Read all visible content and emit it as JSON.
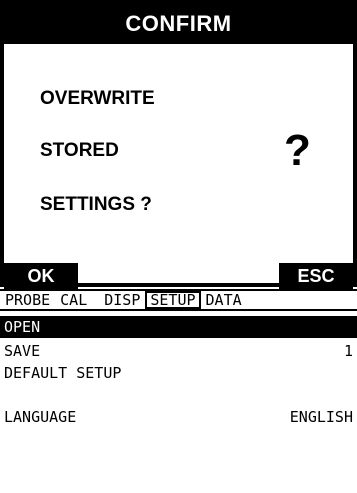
{
  "dialog": {
    "title": "CONFIRM",
    "lines": [
      "OVERWRITE",
      "STORED",
      "SETTINGS ?"
    ],
    "question_mark": "?",
    "ok_label": "OK",
    "esc_label": "ESC"
  },
  "tabs": [
    {
      "label": "PROBE",
      "active": false
    },
    {
      "label": "CAL",
      "active": false
    },
    {
      "label": "DISP",
      "active": false
    },
    {
      "label": "SETUP",
      "active": true
    },
    {
      "label": "DATA",
      "active": false
    }
  ],
  "menu": [
    {
      "label": "OPEN",
      "value": "",
      "selected": true
    },
    {
      "label": "SAVE",
      "value": "1",
      "selected": false
    },
    {
      "label": "DEFAULT SETUP",
      "value": "",
      "selected": false
    },
    {
      "label": "",
      "value": "",
      "selected": false
    },
    {
      "label": "LANGUAGE",
      "value": "ENGLISH",
      "selected": false
    }
  ]
}
